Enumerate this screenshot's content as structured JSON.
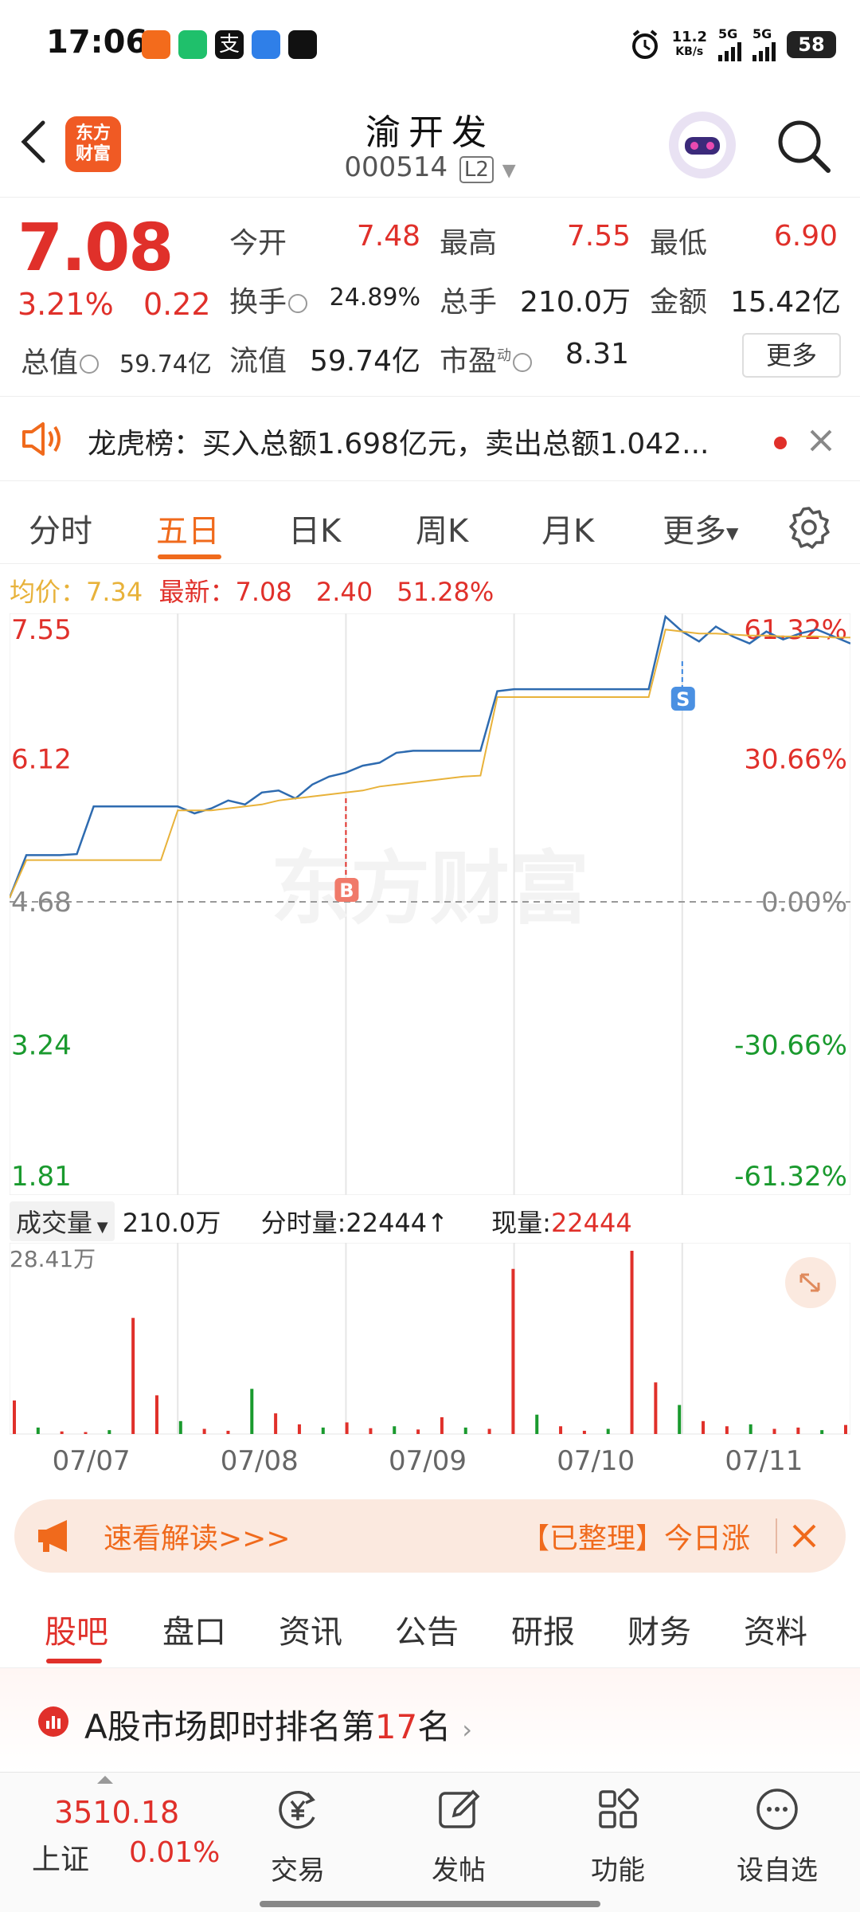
{
  "status_bar": {
    "time": "17:06",
    "net_speed_top": "11.2",
    "net_speed_bottom": "KB/s",
    "net1": "5G",
    "net2": "5G",
    "battery": "58",
    "icons": [
      "app-orange-icon",
      "app-green-phone-icon",
      "alipay-icon",
      "app-blue-icon",
      "telegram-icon",
      "alarm-icon"
    ]
  },
  "header": {
    "logo_text": "东方\n财富",
    "stock_name": "渝开发",
    "stock_code": "000514",
    "level_badge": "L2"
  },
  "quote": {
    "price": "7.08",
    "change_pct": "3.21%",
    "change_abs": "0.22",
    "total_value_label": "总值",
    "total_value": "59.74亿",
    "rows": [
      [
        {
          "label": "今开",
          "value": "7.48"
        },
        {
          "label": "最高",
          "value": "7.55"
        },
        {
          "label": "最低",
          "value": "6.90"
        }
      ],
      [
        {
          "label": "换手",
          "value": "24.89%"
        },
        {
          "label": "总手",
          "value": "210.0万"
        },
        {
          "label": "金额",
          "value": "15.42亿"
        }
      ],
      [
        {
          "label": "流值",
          "value": "59.74亿"
        },
        {
          "label": "市盈",
          "value": "8.31",
          "super": "动"
        }
      ]
    ],
    "more": "更多"
  },
  "notice": {
    "text": "龙虎榜：买入总额1.698亿元，卖出总额1.042..."
  },
  "period_tabs": [
    "分时",
    "五日",
    "日K",
    "周K",
    "月K",
    "更多"
  ],
  "active_period": "五日",
  "avg_strip": {
    "avg_label": "均价：",
    "avg_value": "7.34",
    "latest_label": "最新：",
    "latest_value": "7.08",
    "latest_change": "2.40",
    "latest_pct": "51.28%"
  },
  "chart_data": [
    {
      "type": "line",
      "title": "",
      "x": [
        "07/07",
        "07/08",
        "07/09",
        "07/10",
        "07/11"
      ],
      "y_ticks_left": [
        "7.55",
        "6.12",
        "4.68",
        "3.24",
        "1.81"
      ],
      "y_ticks_right": [
        "61.32%",
        "30.66%",
        "0.00%",
        "-30.66%",
        "-61.32%"
      ],
      "ylim": [
        1.81,
        7.55
      ],
      "base": 4.68,
      "watermark": "东方财富",
      "markers": [
        {
          "label": "B",
          "day": 2
        },
        {
          "label": "S",
          "day": 4
        }
      ],
      "series": [
        {
          "color": "#2e6bb0",
          "values": [
            4.72,
            5.15,
            5.15,
            5.15,
            5.16,
            5.64,
            5.64,
            5.64,
            5.64,
            5.64,
            5.64,
            5.57,
            5.62,
            5.7,
            5.66,
            5.78,
            5.8,
            5.72,
            5.86,
            5.94,
            5.98,
            6.05,
            6.08,
            6.18,
            6.2,
            6.2,
            6.2,
            6.2,
            6.2,
            6.8,
            6.82,
            6.82,
            6.82,
            6.82,
            6.82,
            6.82,
            6.82,
            6.82,
            6.82,
            7.55,
            7.4,
            7.3,
            7.45,
            7.35,
            7.28,
            7.4,
            7.32,
            7.38,
            7.42,
            7.35,
            7.28
          ]
        },
        {
          "color": "#e8b23a",
          "values": [
            4.72,
            5.1,
            5.1,
            5.1,
            5.1,
            5.1,
            5.1,
            5.1,
            5.1,
            5.1,
            5.6,
            5.6,
            5.6,
            5.62,
            5.64,
            5.66,
            5.7,
            5.72,
            5.74,
            5.76,
            5.78,
            5.8,
            5.84,
            5.86,
            5.88,
            5.9,
            5.92,
            5.94,
            5.95,
            6.74,
            6.74,
            6.74,
            6.74,
            6.74,
            6.74,
            6.74,
            6.74,
            6.74,
            6.74,
            7.42,
            7.4,
            7.38,
            7.38,
            7.37,
            7.36,
            7.36,
            7.35,
            7.35,
            7.35,
            7.34,
            7.34
          ]
        }
      ]
    },
    {
      "type": "bar",
      "title": "",
      "ylabel_top": "28.41万",
      "x": [
        "07/07",
        "07/08",
        "07/09",
        "07/10",
        "07/11"
      ],
      "series": [
        {
          "name": "成交量",
          "values": [
            5.2,
            1.0,
            0.4,
            0.3,
            0.6,
            18.0,
            6.0,
            2.0,
            0.8,
            0.5,
            7.0,
            3.2,
            1.5,
            1.0,
            1.8,
            0.9,
            1.2,
            0.7,
            2.6,
            1.0,
            0.8,
            25.6,
            3.0,
            1.2,
            0.5,
            0.8,
            28.41,
            8.0,
            4.5,
            2.0,
            1.2,
            1.5,
            0.8,
            1.0,
            0.6,
            1.4
          ]
        }
      ]
    }
  ],
  "volume_header": {
    "label": "成交量",
    "total": "210.0万",
    "tick_label": "分时量:22444",
    "tick_arrow": "↑",
    "now_label": "现量:",
    "now_value": "22444"
  },
  "analysis": {
    "left_text": "速看解读>>>",
    "right_text": "【已整理】今日涨"
  },
  "content_tabs": [
    "股吧",
    "盘口",
    "资讯",
    "公告",
    "研报",
    "财务",
    "资料"
  ],
  "active_content_tab": "股吧",
  "rank": {
    "prefix": "A股市场即时排名第",
    "number": "17",
    "suffix": "名"
  },
  "bottom_bar": {
    "index_value": "3510.18",
    "index_name": "上证",
    "index_pct": "0.01%",
    "items": [
      {
        "label": "交易",
        "icon": "trade-icon"
      },
      {
        "label": "发帖",
        "icon": "post-icon"
      },
      {
        "label": "功能",
        "icon": "grid-icon"
      },
      {
        "label": "设自选",
        "icon": "more-icon"
      }
    ]
  },
  "colors": {
    "up": "#e0302a",
    "down": "#1a9a2e",
    "accent": "#f06a1c",
    "price_line": "#2e6bb0",
    "avg_line": "#e8b23a"
  }
}
